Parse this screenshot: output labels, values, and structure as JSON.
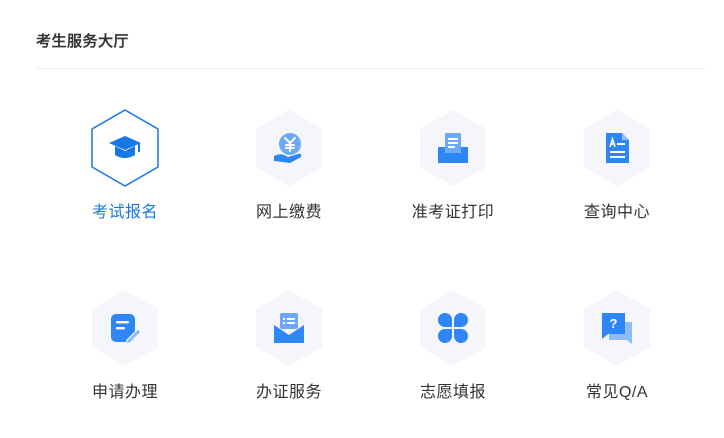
{
  "header": {
    "title": "考生服务大厅"
  },
  "services": [
    {
      "label": "考试报名",
      "icon": "graduation-cap-icon",
      "active": true
    },
    {
      "label": "网上缴费",
      "icon": "yen-coin-hand-icon",
      "active": false
    },
    {
      "label": "准考证打印",
      "icon": "printer-icon",
      "active": false
    },
    {
      "label": "查询中心",
      "icon": "document-search-icon",
      "active": false
    },
    {
      "label": "申请办理",
      "icon": "edit-pen-icon",
      "active": false
    },
    {
      "label": "办证服务",
      "icon": "envelope-card-icon",
      "active": false
    },
    {
      "label": "志愿填报",
      "icon": "clover-icon",
      "active": false
    },
    {
      "label": "常见Q/A",
      "icon": "chat-question-icon",
      "active": false
    }
  ],
  "colors": {
    "accent": "#1677e6",
    "icon_blue": "#2f86f6",
    "hex_bg": "#f4f6fb",
    "text": "#333333"
  }
}
